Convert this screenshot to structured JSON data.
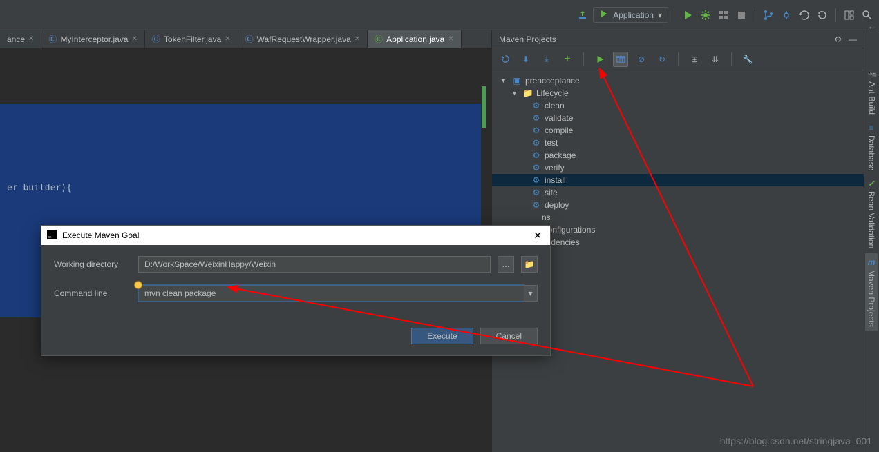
{
  "toolbar": {
    "run_config_label": "Application"
  },
  "tabs": [
    {
      "label": "ance",
      "partial": true
    },
    {
      "label": "MyInterceptor.java"
    },
    {
      "label": "TokenFilter.java"
    },
    {
      "label": "WafRequestWrapper.java"
    },
    {
      "label": "Application.java",
      "active": true
    }
  ],
  "editor": {
    "code_line": "er builder){"
  },
  "maven": {
    "title": "Maven Projects",
    "project": "preacceptance",
    "lifecycle_label": "Lifecycle",
    "phases": [
      "clean",
      "validate",
      "compile",
      "test",
      "package",
      "verify",
      "install",
      "site",
      "deploy"
    ],
    "selected_phase": "install",
    "extra_items": [
      "ns",
      "Configurations",
      "endencies"
    ]
  },
  "dialog": {
    "title": "Execute Maven Goal",
    "working_dir_label": "Working directory",
    "working_dir_value": "D:/WorkSpace/WeixinHappy/Weixin",
    "command_label": "Command line",
    "command_value": "mvn clean package",
    "execute_btn": "Execute",
    "cancel_btn": "Cancel"
  },
  "side_tabs": [
    "Ant Build",
    "Database",
    "Bean Validation",
    "Maven Projects"
  ],
  "side_icons": [
    "🐜",
    "≡",
    "✓",
    "m"
  ],
  "side_icon_colors": [
    "#e8b14f",
    "#4a88c7",
    "#62b543",
    "#4a88c7"
  ],
  "watermark": "https://blog.csdn.net/stringjava_001"
}
